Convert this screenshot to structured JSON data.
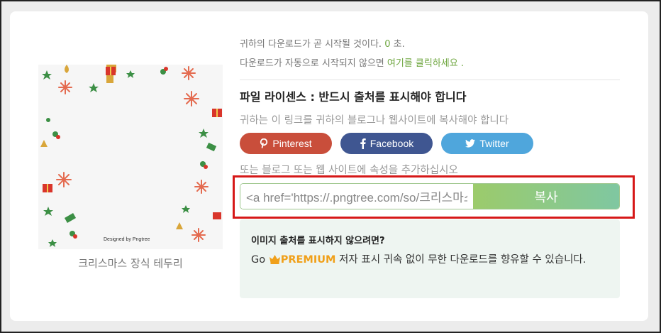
{
  "image": {
    "caption": "크리스마스 장식 테두리",
    "watermark": "Designed by Pngtree"
  },
  "download": {
    "line1_prefix": "귀하의 다운로드가 곧 시작될 것이다. ",
    "countdown": "0",
    "line1_suffix": " 초.",
    "line2_prefix": "다운로드가 자동으로 시작되지 않으면 ",
    "click_link": "여기를 클릭하세요",
    "line2_suffix": " ."
  },
  "license": {
    "title": "파일 라이센스 : 반드시 출처를 표시해야 합니다",
    "subtitle": "귀하는 이 링크를 귀하의 블로그나 웹사이트에 복사해야 합니다"
  },
  "share": [
    {
      "label": "Pinterest",
      "icon": "pinterest-icon",
      "color": "#c94e3b"
    },
    {
      "label": "Facebook",
      "icon": "facebook-icon",
      "color": "#3f5691"
    },
    {
      "label": "Twitter",
      "icon": "twitter-icon",
      "color": "#4fa6dc"
    }
  ],
  "attribution": {
    "prompt": "또는 블로그 또는 웹 사이트에 속성을 추가하십시오",
    "code_value": "<a href='https://.pngtree.com/so/크리스마스'>",
    "copy_label": "복사"
  },
  "premium": {
    "heading": "이미지 출처를 표시하지 않으려면?",
    "go": "Go ",
    "brand": "PREMIUM",
    "text": " 저자 표시 귀속 없이 무한 다운로드를 향유할 수 있습니다."
  }
}
